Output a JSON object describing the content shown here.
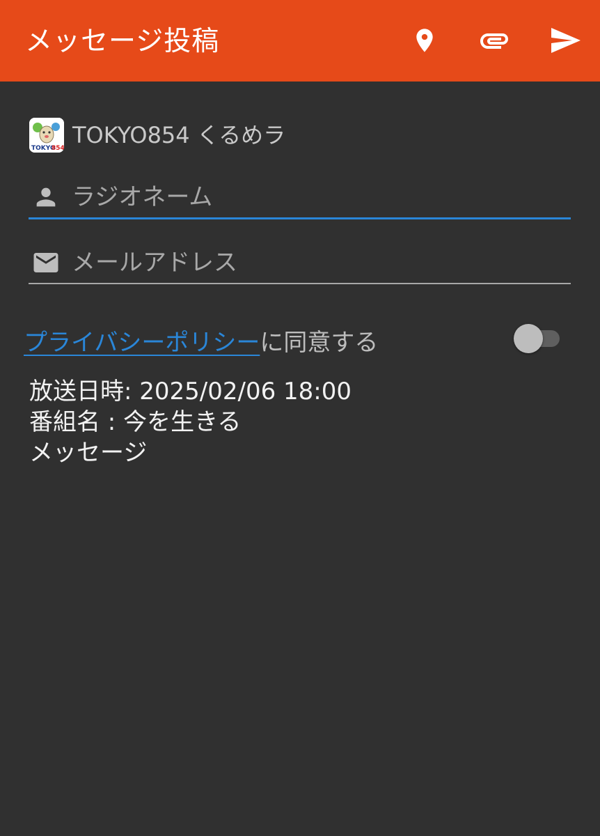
{
  "appbar": {
    "title": "メッセージ投稿",
    "actions": [
      {
        "icon": "location-pin-icon"
      },
      {
        "icon": "paperclip-icon"
      },
      {
        "icon": "send-icon"
      }
    ],
    "color": "#e64a19"
  },
  "account": {
    "logo_text": "TOKYO854",
    "name": "TOKYO854 くるめラ"
  },
  "form": {
    "radio_name_placeholder": "ラジオネーム",
    "email_placeholder": "メールアドレス",
    "radio_name_value": "",
    "email_value": ""
  },
  "consent": {
    "link_text": "プライバシーポリシー",
    "suffix": "に同意する",
    "enabled": false
  },
  "message": {
    "broadcast_line": "放送日時: 2025/02/06 18:00",
    "program_line": "番組名 : 今を生きる",
    "label": "メッセージ"
  },
  "colors": {
    "accent": "#2a86d8",
    "background": "#303030"
  }
}
